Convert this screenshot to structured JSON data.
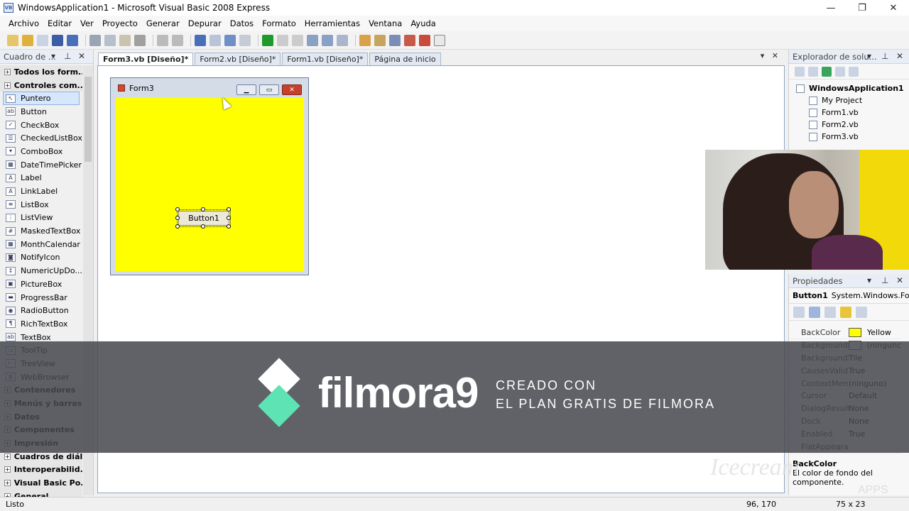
{
  "window": {
    "title": "WindowsApplication1 - Microsoft Visual Basic 2008 Express"
  },
  "menu": [
    "Archivo",
    "Editar",
    "Ver",
    "Proyecto",
    "Generar",
    "Depurar",
    "Datos",
    "Formato",
    "Herramientas",
    "Ventana",
    "Ayuda"
  ],
  "toolbox": {
    "title": "Cuadro de ...",
    "rows": [
      {
        "type": "cat",
        "label": "Todos los form..."
      },
      {
        "type": "cat",
        "label": "Controles com..."
      },
      {
        "type": "item",
        "label": "Puntero",
        "icon": "↖",
        "selected": true
      },
      {
        "type": "item",
        "label": "Button",
        "icon": "ab"
      },
      {
        "type": "item",
        "label": "CheckBox",
        "icon": "✓"
      },
      {
        "type": "item",
        "label": "CheckedListBox",
        "icon": "☰"
      },
      {
        "type": "item",
        "label": "ComboBox",
        "icon": "▾"
      },
      {
        "type": "item",
        "label": "DateTimePicker",
        "icon": "▦"
      },
      {
        "type": "item",
        "label": "Label",
        "icon": "A"
      },
      {
        "type": "item",
        "label": "LinkLabel",
        "icon": "A"
      },
      {
        "type": "item",
        "label": "ListBox",
        "icon": "≡"
      },
      {
        "type": "item",
        "label": "ListView",
        "icon": "⋮"
      },
      {
        "type": "item",
        "label": "MaskedTextBox",
        "icon": "#"
      },
      {
        "type": "item",
        "label": "MonthCalendar",
        "icon": "▦"
      },
      {
        "type": "item",
        "label": "NotifyIcon",
        "icon": "◙"
      },
      {
        "type": "item",
        "label": "NumericUpDo...",
        "icon": "↕"
      },
      {
        "type": "item",
        "label": "PictureBox",
        "icon": "▣"
      },
      {
        "type": "item",
        "label": "ProgressBar",
        "icon": "▬"
      },
      {
        "type": "item",
        "label": "RadioButton",
        "icon": "◉"
      },
      {
        "type": "item",
        "label": "RichTextBox",
        "icon": "¶"
      },
      {
        "type": "item",
        "label": "TextBox",
        "icon": "ab"
      },
      {
        "type": "item",
        "label": "ToolTip",
        "icon": "▭"
      },
      {
        "type": "item",
        "label": "TreeView",
        "icon": "⊢"
      },
      {
        "type": "item",
        "label": "WebBrowser",
        "icon": "◍"
      },
      {
        "type": "cat",
        "label": "Contenedores"
      },
      {
        "type": "cat",
        "label": "Menús y barras..."
      },
      {
        "type": "cat",
        "label": "Datos"
      },
      {
        "type": "cat",
        "label": "Componentes"
      },
      {
        "type": "cat",
        "label": "Impresión"
      },
      {
        "type": "cat",
        "label": "Cuadros de diál..."
      },
      {
        "type": "cat",
        "label": "Interoperabilid..."
      },
      {
        "type": "cat",
        "label": "Visual Basic Po..."
      },
      {
        "type": "cat",
        "label": "General"
      }
    ]
  },
  "tabs": [
    "Form3.vb [Diseño]*",
    "Form2.vb [Diseño]*",
    "Form1.vb [Diseño]*",
    "Página de inicio"
  ],
  "form3": {
    "title": "Form3",
    "button_label": "Button1",
    "back_color": "#ffff00"
  },
  "solution_explorer": {
    "title": "Explorador de solu...",
    "items": [
      "WindowsApplication1",
      "My Project",
      "Form1.vb",
      "Form2.vb",
      "Form3.vb"
    ]
  },
  "properties": {
    "title": "Propiedades",
    "object_name": "Button1",
    "object_type": "System.Windows.For",
    "rows": [
      {
        "name": "BackColor",
        "value": "Yellow",
        "swatch": "#ffff00"
      },
      {
        "name": "BackgroundI",
        "value": "(ningunc",
        "swatch": "#ffffff"
      },
      {
        "name": "BackgroundI",
        "value": "Tile"
      },
      {
        "name": "CausesValida",
        "value": "True"
      },
      {
        "name": "ContextMen",
        "value": "(ninguno)"
      },
      {
        "name": "Cursor",
        "value": "Default"
      },
      {
        "name": "DialogResult",
        "value": "None"
      },
      {
        "name": "Dock",
        "value": "None"
      },
      {
        "name": "Enabled",
        "value": "True"
      },
      {
        "name": "FlatAppearar",
        "value": ""
      }
    ],
    "desc_title": "BackColor",
    "desc_text": "El color de fondo del componente."
  },
  "banner": {
    "brand": "filmora9",
    "tagline1": "CREADO CON",
    "tagline2": "EL PLAN GRATIS DE FILMORA",
    "accent": "#5de3b4"
  },
  "watermark": {
    "main": "Icecream",
    "sub": "APPS"
  },
  "status": {
    "main": "Listo",
    "position": "96, 170",
    "size": "75 x 23"
  }
}
